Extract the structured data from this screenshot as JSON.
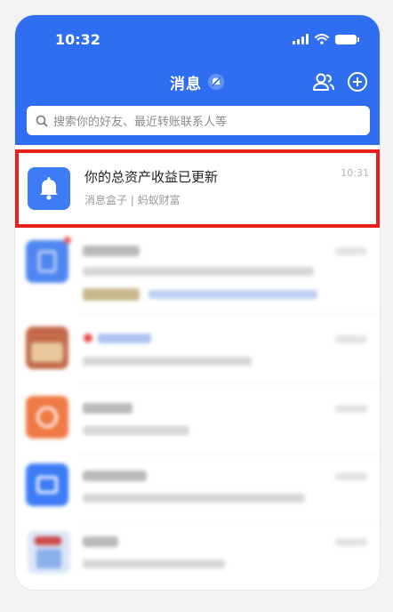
{
  "status_bar": {
    "time": "10:32"
  },
  "header": {
    "title": "消息",
    "search_placeholder": "搜索你的好友、最近转账联系人等"
  },
  "highlighted_message": {
    "title": "你的总资产收益已更新",
    "subtitle": "消息盒子 | 蚂蚁财富",
    "time": "10:31"
  },
  "colors": {
    "brand_blue": "#2f6ef1",
    "highlight_red": "#e8201c",
    "orange_icon": "#ef7a45"
  },
  "icons": {
    "mute": "mute-bell-icon",
    "contacts": "contacts-icon",
    "add": "add-circle-icon",
    "search": "search-icon",
    "bell": "bell-icon"
  }
}
